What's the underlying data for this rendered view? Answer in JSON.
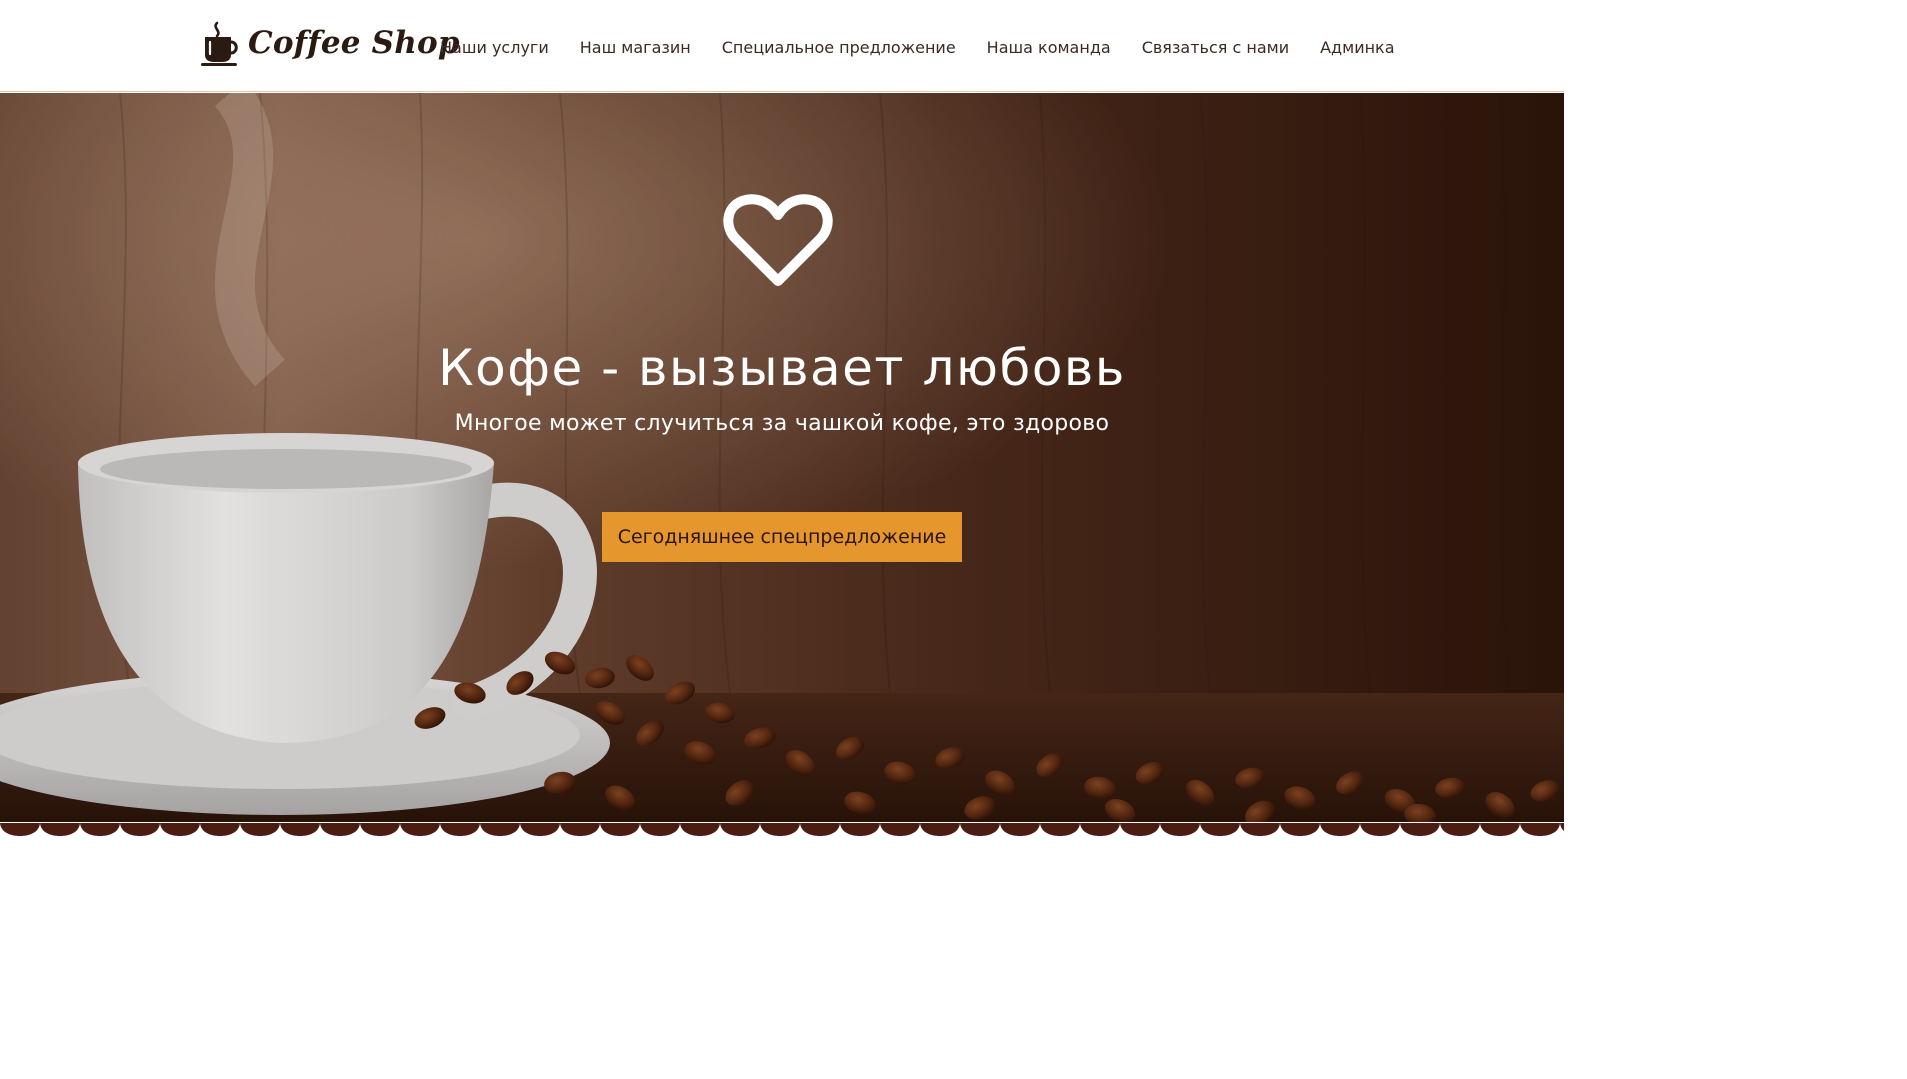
{
  "brand": {
    "name": "Coffee Shop",
    "icon": "coffee-cup-icon"
  },
  "nav": {
    "items": [
      {
        "label": "Наши услуги"
      },
      {
        "label": "Наш магазин"
      },
      {
        "label": "Специальное предложение"
      },
      {
        "label": "Наша команда"
      },
      {
        "label": "Связаться с нами"
      },
      {
        "label": "Админка"
      }
    ]
  },
  "hero": {
    "icon": "heart-icon",
    "title": "Кофе - вызывает любовь",
    "subtitle": "Многое может случиться за чашкой кофе, это здорово",
    "cta_label": "Сегодняшнее спецпредложение",
    "background": "coffee-cup-and-beans-photo"
  },
  "colors": {
    "accent": "#e5962d",
    "brown_dark": "#3a1a0f",
    "nav_text": "#3a2a22",
    "white": "#ffffff"
  }
}
